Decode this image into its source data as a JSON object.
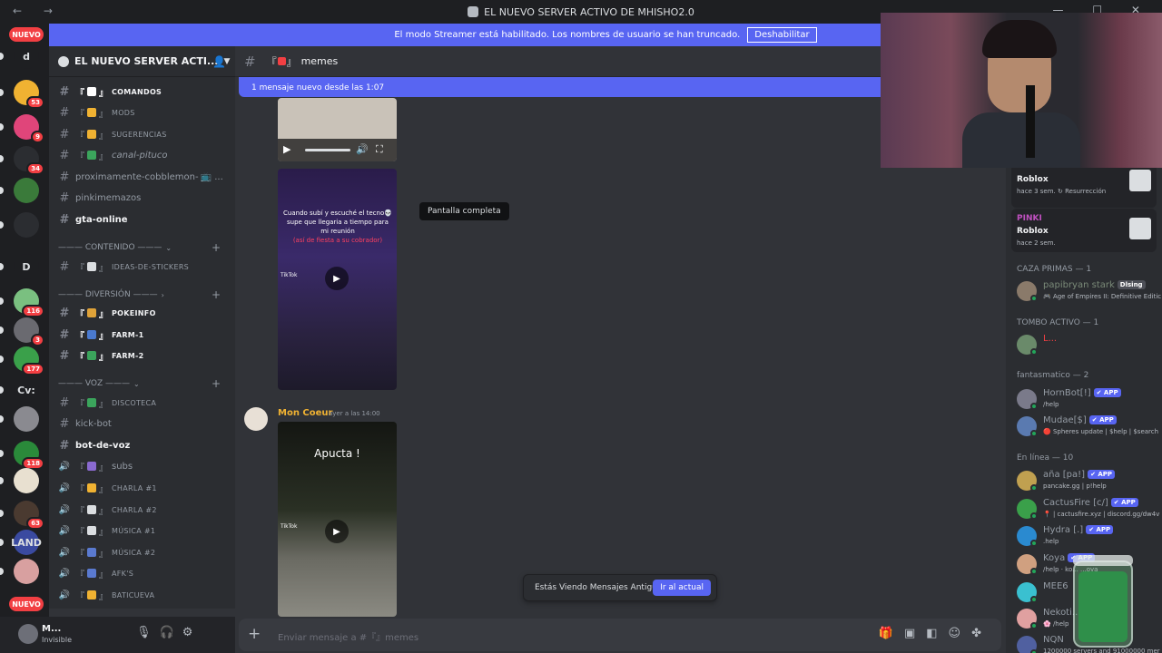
{
  "window": {
    "title": "EL NUEVO SERVER ACTIVO DE MHISHO2.0",
    "nav_icons": "← →",
    "controls": "— ☐ ✕"
  },
  "banner": {
    "text": "El modo Streamer está habilitado. Los nombres de usuario se han truncado.",
    "button": "Deshabilitar"
  },
  "guilds": {
    "top_badge": "NUEVO",
    "bottom_badge": "NUEVO",
    "items": [
      {
        "label": "d"
      },
      {
        "label": "",
        "badge": "53"
      },
      {
        "label": "",
        "badge": "9"
      },
      {
        "label": "",
        "badge": "34"
      },
      {
        "label": ""
      },
      {
        "label": ""
      },
      {
        "label": "D"
      },
      {
        "label": "",
        "badge": "116"
      },
      {
        "label": "",
        "badge": "3"
      },
      {
        "label": "",
        "badge": "177"
      },
      {
        "label": "Cv:"
      },
      {
        "label": ""
      },
      {
        "label": "",
        "badge": "118"
      },
      {
        "label": ""
      },
      {
        "label": "",
        "badge": "63"
      },
      {
        "label": "LAND"
      },
      {
        "label": ""
      }
    ]
  },
  "server": {
    "name": "EL NUEVO SERVER ACTI...",
    "channels": [
      {
        "name": "COMANDOS",
        "prefix": "『",
        "suffix": "』",
        "type": "text",
        "unread": true,
        "arrow": true,
        "smallcaps": true
      },
      {
        "name": "MODS",
        "prefix": "『",
        "suffix": "』",
        "type": "text",
        "unread": false,
        "smallcaps": true
      },
      {
        "name": "SUGERENCIAS",
        "prefix": "『",
        "suffix": "』",
        "type": "text",
        "unread": false,
        "smallcaps": true
      },
      {
        "name": "canal-pituco",
        "prefix": "『",
        "suffix": "』",
        "type": "text",
        "unread": false,
        "italic": true
      },
      {
        "name": "proximamente-cobblemon-",
        "type": "text",
        "unread": false,
        "trail": "📺 ..."
      },
      {
        "name": "pinkimemazos",
        "type": "text",
        "unread": false
      },
      {
        "name": "gta-online",
        "type": "text",
        "unread": true
      }
    ],
    "category_contenido": "——— CONTENIDO ———",
    "contenido_channels": [
      {
        "name": "IDEAS-DE-STICKERS",
        "prefix": "『",
        "suffix": "』",
        "smallcaps": true
      }
    ],
    "category_diversion": "——— DIVERSIÓN ———",
    "diversion_channels": [
      {
        "name": "POKEINFO",
        "prefix": "『",
        "suffix": "』",
        "unread": true,
        "arrow": true,
        "smallcaps": true
      },
      {
        "name": "FARM-1",
        "prefix": "『",
        "suffix": "』",
        "unread": true,
        "arrow": true,
        "smallcaps": true
      },
      {
        "name": "FARM-2",
        "prefix": "『",
        "suffix": "』",
        "unread": true,
        "arrow": true,
        "smallcaps": true
      }
    ],
    "category_voz": "——— VOZ ———",
    "voz_channels": [
      {
        "name": "DISCOTECA",
        "prefix": "『",
        "suffix": "』",
        "type": "text",
        "smallcaps": true
      },
      {
        "name": "kick-bot",
        "type": "text"
      },
      {
        "name": "bot-de-voz",
        "type": "text",
        "unread": true
      },
      {
        "name": "subs",
        "prefix": "『",
        "suffix": "』",
        "type": "voice"
      },
      {
        "name": "CHARLA #1",
        "prefix": "『",
        "suffix": "』",
        "type": "voice",
        "smallcaps": true
      },
      {
        "name": "CHARLA #2",
        "prefix": "『",
        "suffix": "』",
        "type": "voice",
        "smallcaps": true
      },
      {
        "name": "MÚSICA #1",
        "prefix": "『",
        "suffix": "』",
        "type": "voice",
        "smallcaps": true
      },
      {
        "name": "MÚSICA #2",
        "prefix": "『",
        "suffix": "』",
        "type": "voice",
        "smallcaps": true
      },
      {
        "name": "AFK'S",
        "prefix": "『",
        "suffix": "』",
        "type": "voice",
        "smallcaps": true
      },
      {
        "name": "BATICUEVA",
        "prefix": "『",
        "suffix": "』",
        "type": "voice",
        "smallcaps": true
      }
    ]
  },
  "user": {
    "name": "M...",
    "status": "Invisible"
  },
  "chat": {
    "channel_name": "memes",
    "channel_prefix": "『",
    "channel_suffix": "』",
    "new_messages": "1 mensaje nuevo desde las 1:07",
    "tooltip": "Pantalla completa",
    "tiktok_caption": "Cuando subí y escuché el tecno💀 supe que llegaria a tiempo para mi reunión",
    "tiktok_caption_red": "(así de fiesta a su cobrador)",
    "tiktok_label": "TikTok",
    "message": {
      "author": "Mon Coeur",
      "time": "ayer a las 14:00",
      "video_caption": "Apucta !"
    },
    "jump_text": "Estás Viendo Mensajes Antiguos",
    "jump_button": "Ir al actual",
    "composer_placeholder": "Enviar mensaje a #『』memes"
  },
  "members": {
    "activities": [
      {
        "user": "",
        "game": "Roblox",
        "meta": "hace 3 sem.  ↻ Resurrección"
      },
      {
        "user": "PINKI",
        "game": "Roblox",
        "meta": "hace 2 sem."
      }
    ],
    "groups": [
      {
        "title": "CAZA PRIMAS — 1",
        "members": [
          {
            "name": "papibryan stark",
            "tag": "Dlsing",
            "status": "🎮 Age of Empires II: Definitive Editic",
            "color": "#7a8a78"
          }
        ]
      },
      {
        "title": "TOMBO ACTIVO — 1",
        "members": [
          {
            "name": "L...",
            "status": "",
            "color": "#f23f43"
          }
        ]
      },
      {
        "title": "fantasmatico — 2",
        "members": [
          {
            "name": "HornBot[!]",
            "app": "✔ APP",
            "status": "/help",
            "color": "#949ba4"
          },
          {
            "name": "Mudae[$]",
            "app": "✔ APP",
            "status": "🔴 Spheres update | $help | $search",
            "color": "#949ba4"
          }
        ]
      },
      {
        "title": "En línea — 10",
        "members": [
          {
            "name": "aña [pa!]",
            "app": "✔ APP",
            "status": "pancake.gg | p!help",
            "color": "#949ba4"
          },
          {
            "name": "CactusFire [c/]",
            "app": "✔ APP",
            "status": "📍 | cactusfire.xyz | discord.gg/dw4v",
            "color": "#949ba4"
          },
          {
            "name": "Hydra [.]",
            "app": "✔ APP",
            "status": ".help",
            "color": "#949ba4"
          },
          {
            "name": "Koya",
            "app": "✔ APP",
            "status": "/help · ko...  ...oya",
            "color": "#949ba4"
          },
          {
            "name": "MEE6",
            "app": "",
            "status": "",
            "color": "#949ba4"
          },
          {
            "name": "Nekoti...",
            "app": "",
            "status": "🌸 /help",
            "color": "#949ba4"
          },
          {
            "name": "NQN",
            "app": "",
            "status": "1200000 servers and 91000000 mer",
            "color": "#949ba4"
          }
        ]
      }
    ]
  },
  "colors": {
    "accent": "#5865f2",
    "badge_red": "#f23f43",
    "online": "#23a55a",
    "author": "#f0b232"
  }
}
